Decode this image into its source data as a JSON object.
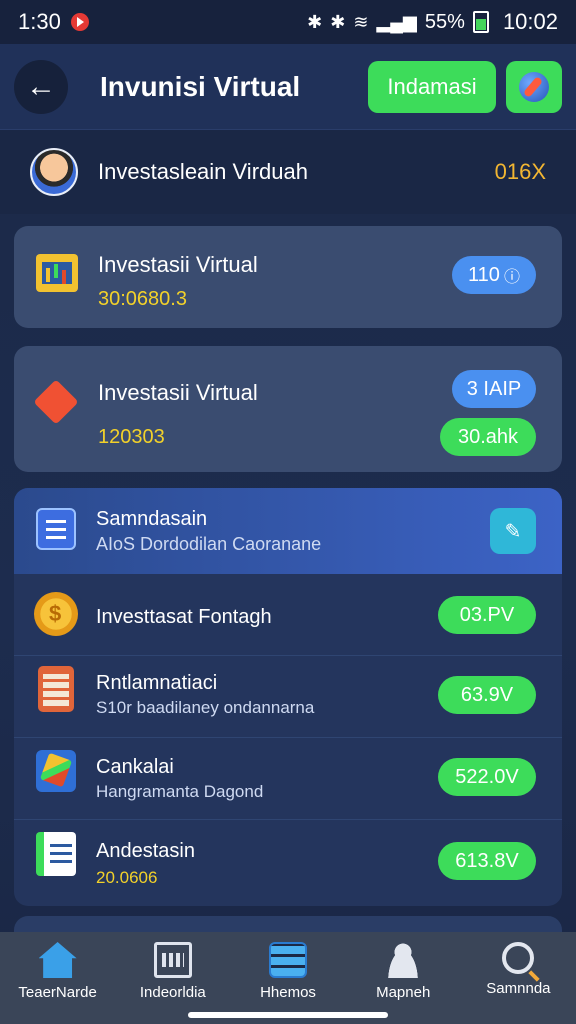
{
  "status_bar": {
    "time_left": "1:30",
    "battery_pct": "55%",
    "time_right": "10:02"
  },
  "header": {
    "title": "Invunisi Virtual",
    "action_label": "Indamasi",
    "icon": "rocket-icon"
  },
  "profile": {
    "name": "Investasleain Virduah",
    "value": "016X"
  },
  "cards": [
    {
      "title": "Investasii Virtual",
      "subtitle": "30:0680.3",
      "badge": "110",
      "icon": "chart-icon"
    },
    {
      "title": "Investasii Virtual",
      "subtitle": "120303",
      "badge": "3 IAIP",
      "badge2": "30.ahk",
      "icon": "diamond-icon"
    }
  ],
  "list_header": {
    "title": "Samndasain",
    "subtitle": "AIoS Dordodilan Caoranane",
    "icon": "edit-icon"
  },
  "rows": [
    {
      "title": "Investtasat Fontagh",
      "subtitle": "",
      "value": "03.PV",
      "icon": "coin-icon"
    },
    {
      "title": "Rntlamnatiaci",
      "subtitle": "S10r baadilaney ondannarna",
      "value": "63.9V",
      "icon": "calculator-icon"
    },
    {
      "title": "Cankalai",
      "subtitle": "Hangramanta Dagond",
      "value": "522.0V",
      "icon": "tools-icon"
    },
    {
      "title": "Andestasin",
      "subtitle": "20.0606",
      "value": "613.8V",
      "icon": "spreadsheet-icon"
    }
  ],
  "nav": [
    {
      "label": "TeaerNarde",
      "icon": "home-icon"
    },
    {
      "label": "Indeorldia",
      "icon": "store-icon"
    },
    {
      "label": "Hhemos",
      "icon": "database-icon"
    },
    {
      "label": "Mapneh",
      "icon": "person-icon"
    },
    {
      "label": "Samnnda",
      "icon": "search-icon"
    }
  ],
  "colors": {
    "accent_green": "#3ddc5a",
    "accent_blue": "#4a90f0",
    "value_yellow": "#f2d12a",
    "background": "#1b2947"
  }
}
